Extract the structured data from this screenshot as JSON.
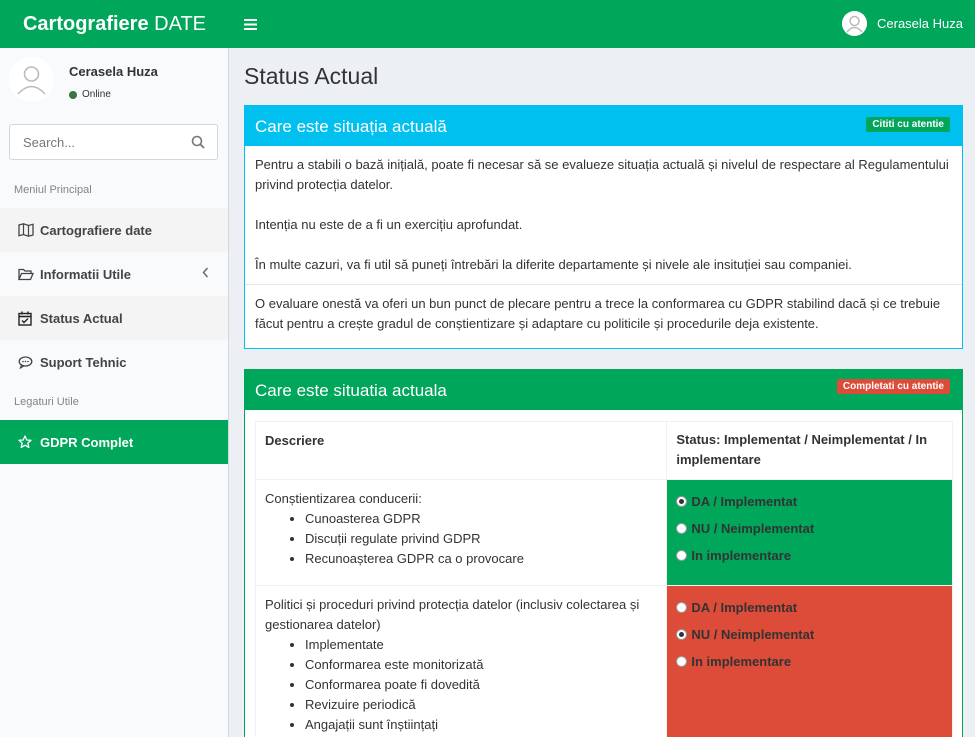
{
  "header": {
    "logo_bold": "Cartografiere",
    "logo_rest": " DATE",
    "user_name": "Cerasela Huza"
  },
  "sidebar": {
    "user_name": "Cerasela Huza",
    "user_status": "Online",
    "search_placeholder": "Search...",
    "section_main": "Meniul Principal",
    "section_links": "Legaturi Utile",
    "items": [
      {
        "label": "Cartografiere date"
      },
      {
        "label": "Informatii Utile"
      },
      {
        "label": "Status Actual"
      },
      {
        "label": "Suport Tehnic"
      },
      {
        "label": "GDPR Complet"
      }
    ]
  },
  "content": {
    "page_title": "Status Actual",
    "box1": {
      "title": "Care este situația actuală",
      "badge": "Cititi cu atentie",
      "paragraphs": [
        "Pentru a stabili o bază inițială, poate fi necesar să se evalueze situația actuală și nivelul de respectare al Regulamentului privind protecția datelor.",
        "Intenția nu este de a fi un exercițiu aprofundat.",
        "În multe cazuri, va fi util să puneți întrebări la diferite departamente și nivele ale insituției sau companiei.",
        "O evaluare onestă va oferi un bun punct de plecare pentru a trece la conformarea cu GDPR stabilind dacă și ce trebuie făcut pentru a crește gradul de conștientizare și adaptare cu politicile și procedurile deja existente."
      ]
    },
    "box2": {
      "title": "Care este situatia actuala",
      "badge": "Completati cu atentie",
      "col_description": "Descriere",
      "col_status": "Status: Implementat / Neimplementat / In implementare",
      "rows": [
        {
          "title": "Conștientizarea conducerii:",
          "items": [
            "Cunoasterea GDPR",
            "Discuții regulate privind GDPR",
            "Recunoașterea GDPR ca o provocare"
          ],
          "options": [
            "DA / Implementat",
            "NU / Neimplementat",
            "In implementare"
          ],
          "selected": 0,
          "status_color": "#00a65a"
        },
        {
          "title": "Politici și proceduri privind protecția datelor (inclusiv colectarea și gestionarea datelor)",
          "items": [
            "Implementate",
            "Conformarea este monitorizată",
            "Conformarea poate fi dovedită",
            "Revizuire periodică",
            "Angajații sunt înștiințați"
          ],
          "options": [
            "DA / Implementat",
            "NU / Neimplementat",
            "In implementare"
          ],
          "selected": 1,
          "status_color": "#dd4b39"
        }
      ]
    }
  },
  "colors": {
    "brand_green": "#00a65a",
    "info_blue": "#00c0ef",
    "danger_red": "#dd4b39"
  },
  "icons": [
    "hamburger-menu-icon",
    "user-avatar-icon",
    "search-icon",
    "map-icon",
    "folder-open-icon",
    "chevron-left-icon",
    "calendar-check-icon",
    "comment-icon",
    "star-icon"
  ]
}
